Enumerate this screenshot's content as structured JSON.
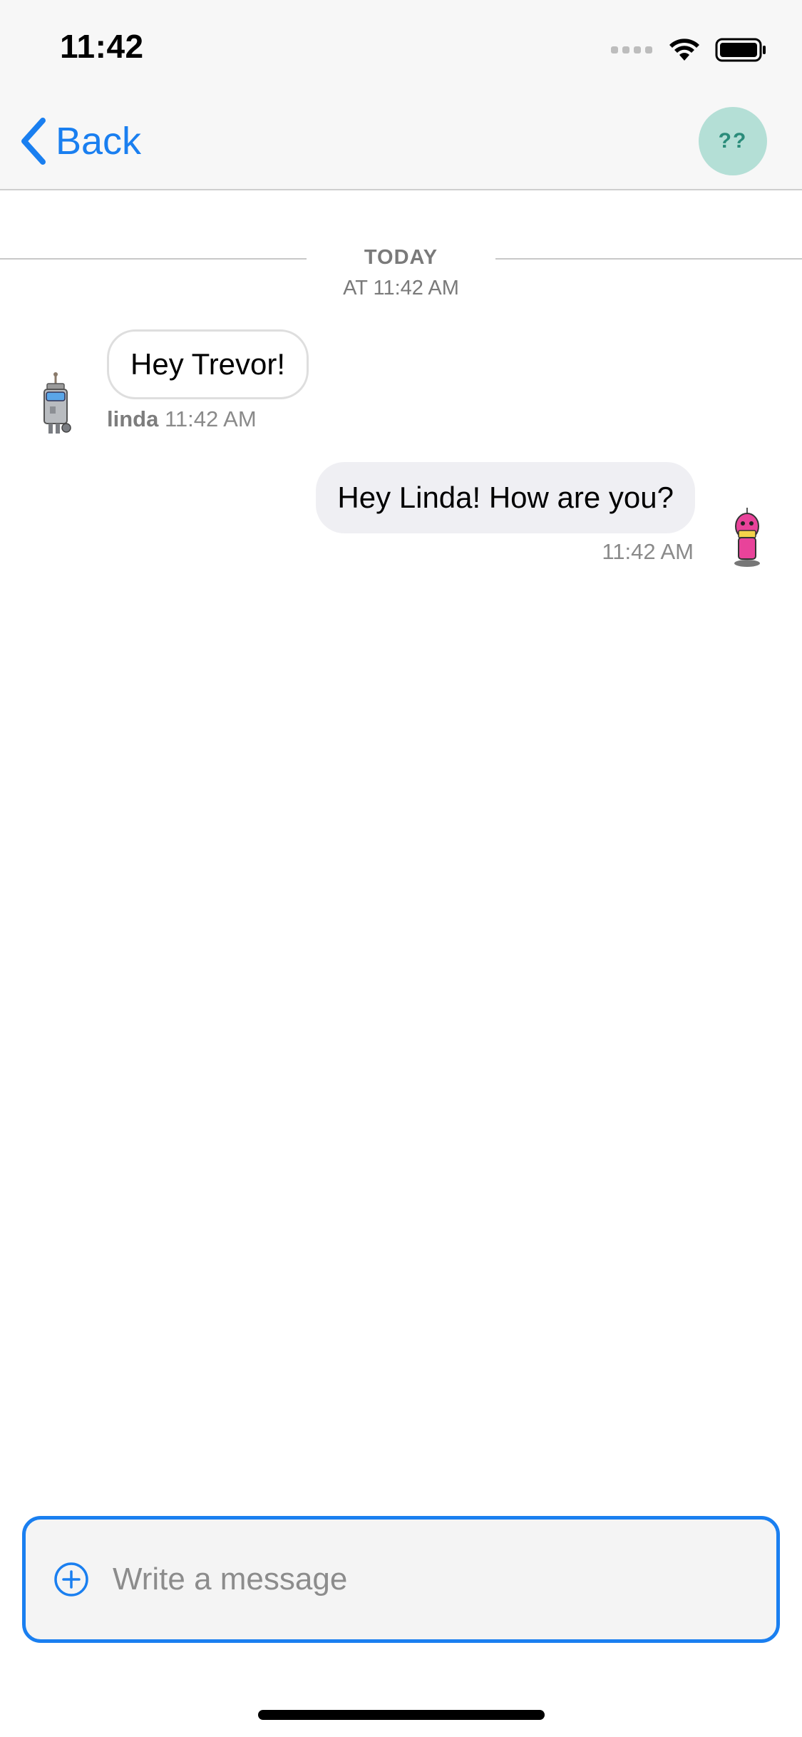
{
  "status_bar": {
    "time": "11:42"
  },
  "nav": {
    "back_label": "Back",
    "avatar_initials": "??",
    "avatar_color": "#b4dfd6",
    "accent_color": "#1a7ff0"
  },
  "date_divider": {
    "day": "TODAY",
    "time": "AT 11:42 AM"
  },
  "messages": [
    {
      "direction": "incoming",
      "text": "Hey Trevor!",
      "sender": "linda",
      "time": "11:42 AM",
      "avatar_icon": "robot-avatar-icon"
    },
    {
      "direction": "outgoing",
      "text": "Hey Linda! How are you?",
      "time": "11:42 AM",
      "avatar_icon": "pink-robot-avatar-icon"
    }
  ],
  "composer": {
    "placeholder": "Write a message",
    "attach_icon": "plus-circle-icon"
  }
}
